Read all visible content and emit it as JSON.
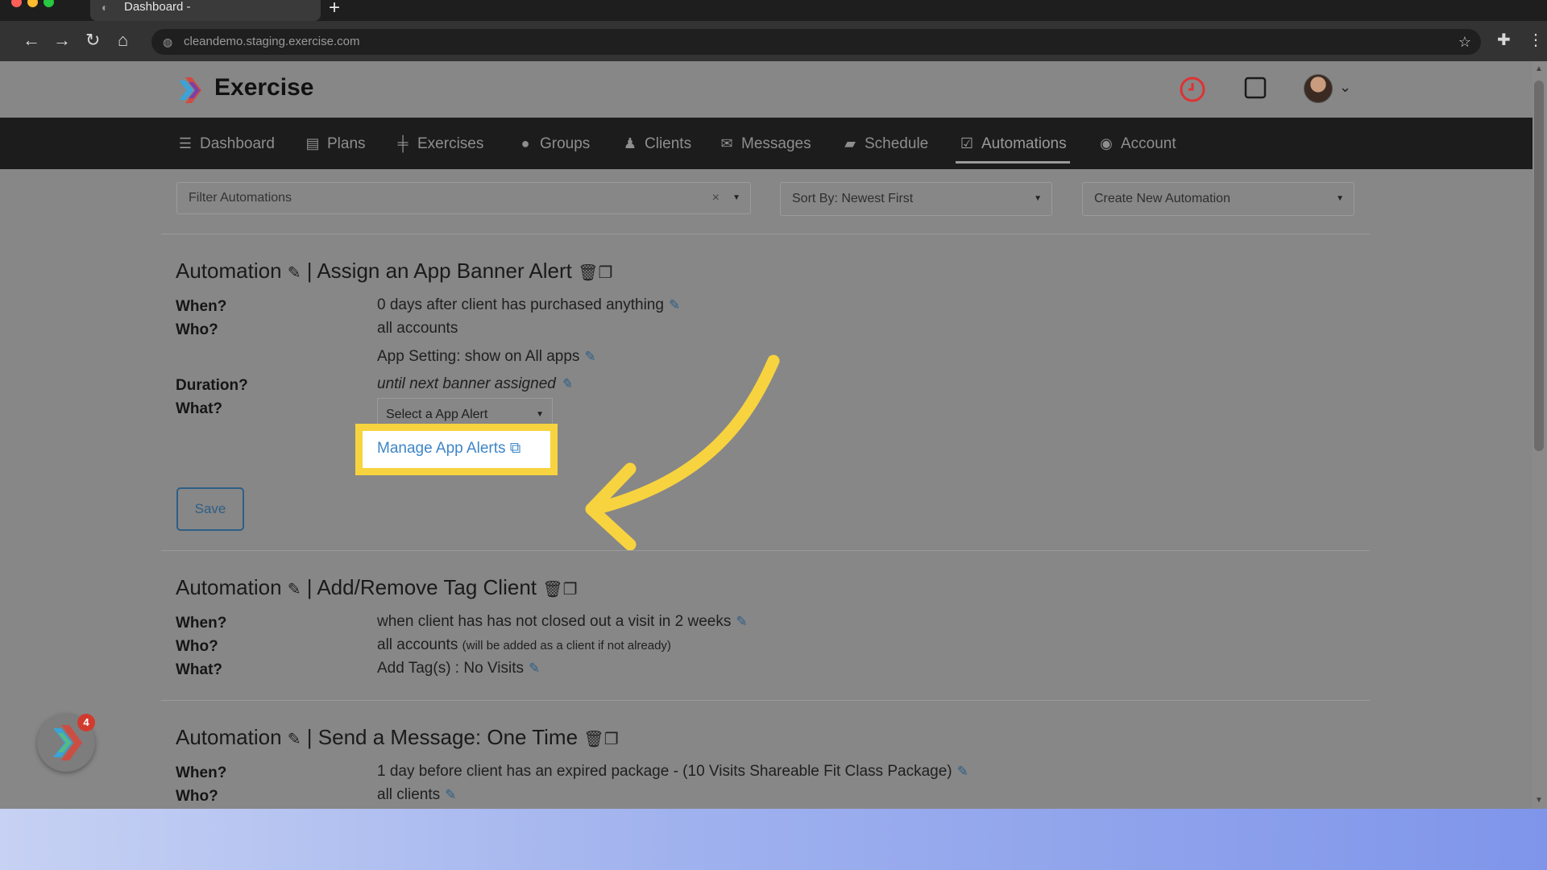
{
  "browser": {
    "tab_title": "Dashboard -",
    "new_tab_symbol": "+",
    "url": "cleandemo.staging.exercise.com",
    "icons": [
      "back-icon",
      "forward-icon",
      "reload-icon",
      "home-icon",
      "site-info-icon",
      "bookmark-star-icon",
      "extensions-icon",
      "browser-menu-icon"
    ]
  },
  "header": {
    "brand": "Exercise",
    "icons": [
      "clock-icon",
      "square-icon",
      "avatar",
      "chevron-down-icon"
    ]
  },
  "nav": {
    "items": [
      {
        "label": "Dashboard",
        "icon": "list-icon"
      },
      {
        "label": "Plans",
        "icon": "clipboard-icon"
      },
      {
        "label": "Exercises",
        "icon": "dumbbell-icon"
      },
      {
        "label": "Groups",
        "icon": "users-icon"
      },
      {
        "label": "Clients",
        "icon": "user-icon"
      },
      {
        "label": "Messages",
        "icon": "envelope-icon"
      },
      {
        "label": "Schedule",
        "icon": "book-icon"
      },
      {
        "label": "Automations",
        "icon": "check-square-icon"
      },
      {
        "label": "Account",
        "icon": "user-circle-icon"
      }
    ],
    "active": "Automations"
  },
  "filters": {
    "filter_placeholder": "Filter Automations",
    "clear_symbol": "×",
    "sort_label": "Sort By: Newest First",
    "create_label": "Create New Automation"
  },
  "automations": [
    {
      "prefix": "Automation",
      "separator": "|",
      "title": "Assign an App Banner Alert",
      "when_label": "When?",
      "when": "0 days after client has purchased anything",
      "who_label": "Who?",
      "who": "all accounts",
      "app_setting": "App Setting: show on All apps",
      "duration_label": "Duration?",
      "duration": "until next banner assigned",
      "what_label": "What?",
      "select_placeholder": "Select a App Alert",
      "manage_link": "Manage App Alerts",
      "save_label": "Save"
    },
    {
      "prefix": "Automation",
      "separator": "|",
      "title": "Add/Remove Tag Client",
      "when_label": "When?",
      "when": "when client has has not closed out a visit in 2 weeks",
      "who_label": "Who?",
      "who": "all accounts",
      "who_note": "(will be added as a client if not already)",
      "what_label": "What?",
      "what": "Add Tag(s) : No Visits"
    },
    {
      "prefix": "Automation",
      "separator": "|",
      "title": "Send a Message: One Time",
      "when_label": "When?",
      "when": "1 day before client has an expired package - (10 Visits Shareable Fit Class Package)",
      "who_label": "Who?",
      "who": "all clients"
    }
  ],
  "chat_widget": {
    "badge_count": "4"
  },
  "colors": {
    "highlight": "#f7d33f",
    "arrow": "#f7d33f",
    "link": "#3e86c8",
    "save_border": "#2e5f86",
    "nav_bg": "#1c1c1c",
    "badge": "#d13b2e"
  }
}
